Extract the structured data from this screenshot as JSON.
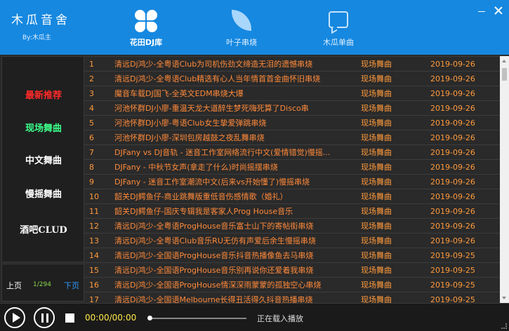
{
  "app": {
    "title": "木瓜音舍",
    "author": "By:木瓜主"
  },
  "nav": {
    "tabs": [
      {
        "label": "花田DJ库",
        "icon": "clover-icon",
        "active": true
      },
      {
        "label": "叶子串烧",
        "icon": "leaf-icon",
        "active": false
      },
      {
        "label": "木瓜单曲",
        "icon": "message-icon",
        "active": false
      }
    ]
  },
  "sidebar": {
    "items": [
      {
        "label": "最新推荐",
        "color": "#ff2a2a"
      },
      {
        "label": "现场舞曲",
        "color": "#3cff8a"
      },
      {
        "label": "中文舞曲",
        "color": "#ffffff"
      },
      {
        "label": "慢摇舞曲",
        "color": "#ffffff"
      },
      {
        "label": "酒吧CLUD",
        "color": "#ffffff"
      }
    ]
  },
  "pager": {
    "prev_label": "上页",
    "info": "1/294",
    "next_label": "下页"
  },
  "songs": [
    {
      "num": "1",
      "title": "清远Dj鸿少-全粤语Club为司机伤劲文缔造无泪的遗憾串烧",
      "category": "现场舞曲",
      "date": "2019-09-26"
    },
    {
      "num": "2",
      "title": "清远Dj鸿少-全粤语Club精选有心人当年情首首金曲怀旧串烧",
      "category": "现场舞曲",
      "date": "2019-09-26"
    },
    {
      "num": "3",
      "title": "魔音车载DJ国飞-全英文EDM串烧大爆",
      "category": "现场舞曲",
      "date": "2019-09-26"
    },
    {
      "num": "4",
      "title": "河池怀群DJ小廖-重温天龙大道醉生梦死嗨死算了Disco串",
      "category": "现场舞曲",
      "date": "2019-09-26"
    },
    {
      "num": "5",
      "title": "河池怀群DJ小廖-粤语Club女生挚爱弹跳串烧",
      "category": "现场舞曲",
      "date": "2019-09-26"
    },
    {
      "num": "6",
      "title": "河池怀群DJ小廖-深圳包房越鼓之夜乱舞串烧",
      "category": "现场舞曲",
      "date": "2019-09-26"
    },
    {
      "num": "7",
      "title": "DJFany vs DJ音轨 - 迷音工作室网络流行中文(爱情错觉)慢摇...",
      "category": "现场舞曲",
      "date": "2019-09-26"
    },
    {
      "num": "8",
      "title": "DJFany - 中秋节女声(拿走了什么)时尚摇摆串烧",
      "category": "现场舞曲",
      "date": "2019-09-26"
    },
    {
      "num": "9",
      "title": "DJFany - 迷音工作室潮流中文(后来vs开始懂了)慢摇串烧",
      "category": "现场舞曲",
      "date": "2019-09-26"
    },
    {
      "num": "10",
      "title": "韶关DJ鳄鱼仔-商业跳舞版重低音伤感情歌（婚礼）",
      "category": "现场舞曲",
      "date": "2019-09-26"
    },
    {
      "num": "11",
      "title": "韶关DJ鳄鱼仔-国庆专辑我是客家人Prog House音乐",
      "category": "现场舞曲",
      "date": "2019-09-26"
    },
    {
      "num": "12",
      "title": "清远Dj鸿少-全粤语ProgHouse音乐富士山下的寄帖街串烧",
      "category": "现场舞曲",
      "date": "2019-09-26"
    },
    {
      "num": "13",
      "title": "清远Dj鸿少-全粤语Club音乐RU无仿有声爱后余生慢摇串烧",
      "category": "现场舞曲",
      "date": "2019-09-26"
    },
    {
      "num": "14",
      "title": "清远Dj鸿少-全国语ProgHouse音乐抖音热播像鱼去马串烧",
      "category": "现场舞曲",
      "date": "2019-09-25"
    },
    {
      "num": "15",
      "title": "清远Dj鸿少-全国语ProgHouse音乐别再说你还爱着我串烧",
      "category": "现场舞曲",
      "date": "2019-09-25"
    },
    {
      "num": "16",
      "title": "清远Dj鸿少-全国语ProgHouse情深深雨蒙蒙的孤独空心串烧",
      "category": "现场舞曲",
      "date": "2019-09-25"
    },
    {
      "num": "17",
      "title": "清远Dj鸿少-全国语Melbourne长得丑活得久抖音热播串烧",
      "category": "现场舞曲",
      "date": "2019-09-25"
    }
  ],
  "player": {
    "time": "00:00/00:00",
    "status": "正在载入播放",
    "progress": 0
  }
}
